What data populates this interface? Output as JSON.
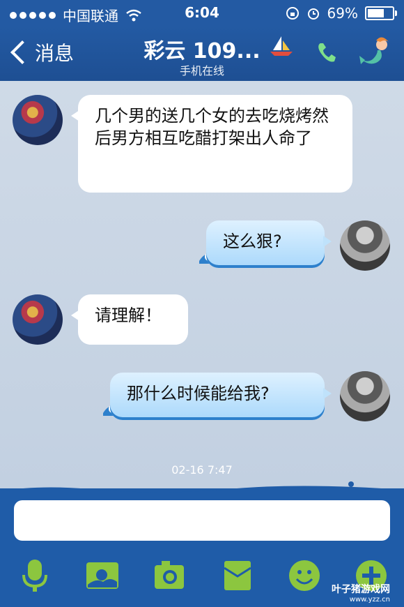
{
  "status_bar": {
    "carrier": "中国联通",
    "time": "6:04",
    "battery": "69%",
    "battery_fraction": 0.69
  },
  "nav": {
    "back_label": "消息",
    "title": "彩云 109...",
    "subtitle": "手机在线"
  },
  "messages": [
    {
      "from": "contact",
      "text": "几个男的送几个女的去吃烧烤然后男方相互吃醋打架出人命了"
    },
    {
      "from": "me",
      "text": "这么狠?"
    },
    {
      "from": "contact",
      "text": "请理解！"
    },
    {
      "from": "me",
      "text": "那什么时候能给我?"
    }
  ],
  "timestamp": "02-16 7:47",
  "input": {
    "placeholder": ""
  },
  "toolbar": [
    "microphone-icon",
    "image-icon",
    "camera-icon",
    "folder-icon",
    "emoji-icon",
    "plus-icon"
  ],
  "watermark": {
    "brand": "叶子猪游戏网",
    "url": "www.yzz.cn"
  },
  "colors": {
    "nav": "#235aa3",
    "chat_bg": "#c5d2e1",
    "toolbar_green": "#8cc63f",
    "bubble_out": "#a9d8fb"
  }
}
